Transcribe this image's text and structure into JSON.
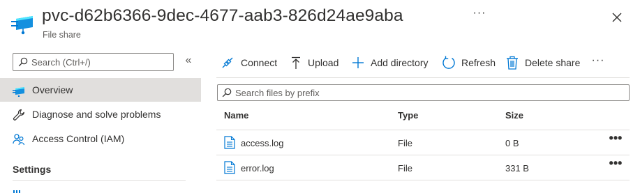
{
  "header": {
    "title": "pvc-d62b6366-9dec-4677-aab3-826d24ae9aba",
    "subtitle": "File share",
    "more_label": "···",
    "icon": "file-share-icon"
  },
  "sidebar": {
    "search_placeholder": "Search (Ctrl+/)",
    "collapse_label": "«",
    "items": [
      {
        "label": "Overview",
        "icon": "file-share-icon",
        "active": true
      },
      {
        "label": "Diagnose and solve problems",
        "icon": "wrench-icon"
      },
      {
        "label": "Access Control (IAM)",
        "icon": "people-icon"
      }
    ],
    "section": "Settings"
  },
  "toolbar": {
    "connect": "Connect",
    "upload": "Upload",
    "add_directory": "Add directory",
    "refresh": "Refresh",
    "delete_share": "Delete share",
    "more_label": "···"
  },
  "file_search": {
    "placeholder": "Search files by prefix"
  },
  "table": {
    "columns": [
      "Name",
      "Type",
      "Size"
    ],
    "rows": [
      {
        "name": "access.log",
        "type": "File",
        "size": "0 B"
      },
      {
        "name": "error.log",
        "type": "File",
        "size": "331 B"
      }
    ],
    "row_more_label": "•••"
  },
  "colors": {
    "accent": "#0078d4",
    "active_nav": "#e1dfdd",
    "icon_cyan": "#50e6ff"
  }
}
